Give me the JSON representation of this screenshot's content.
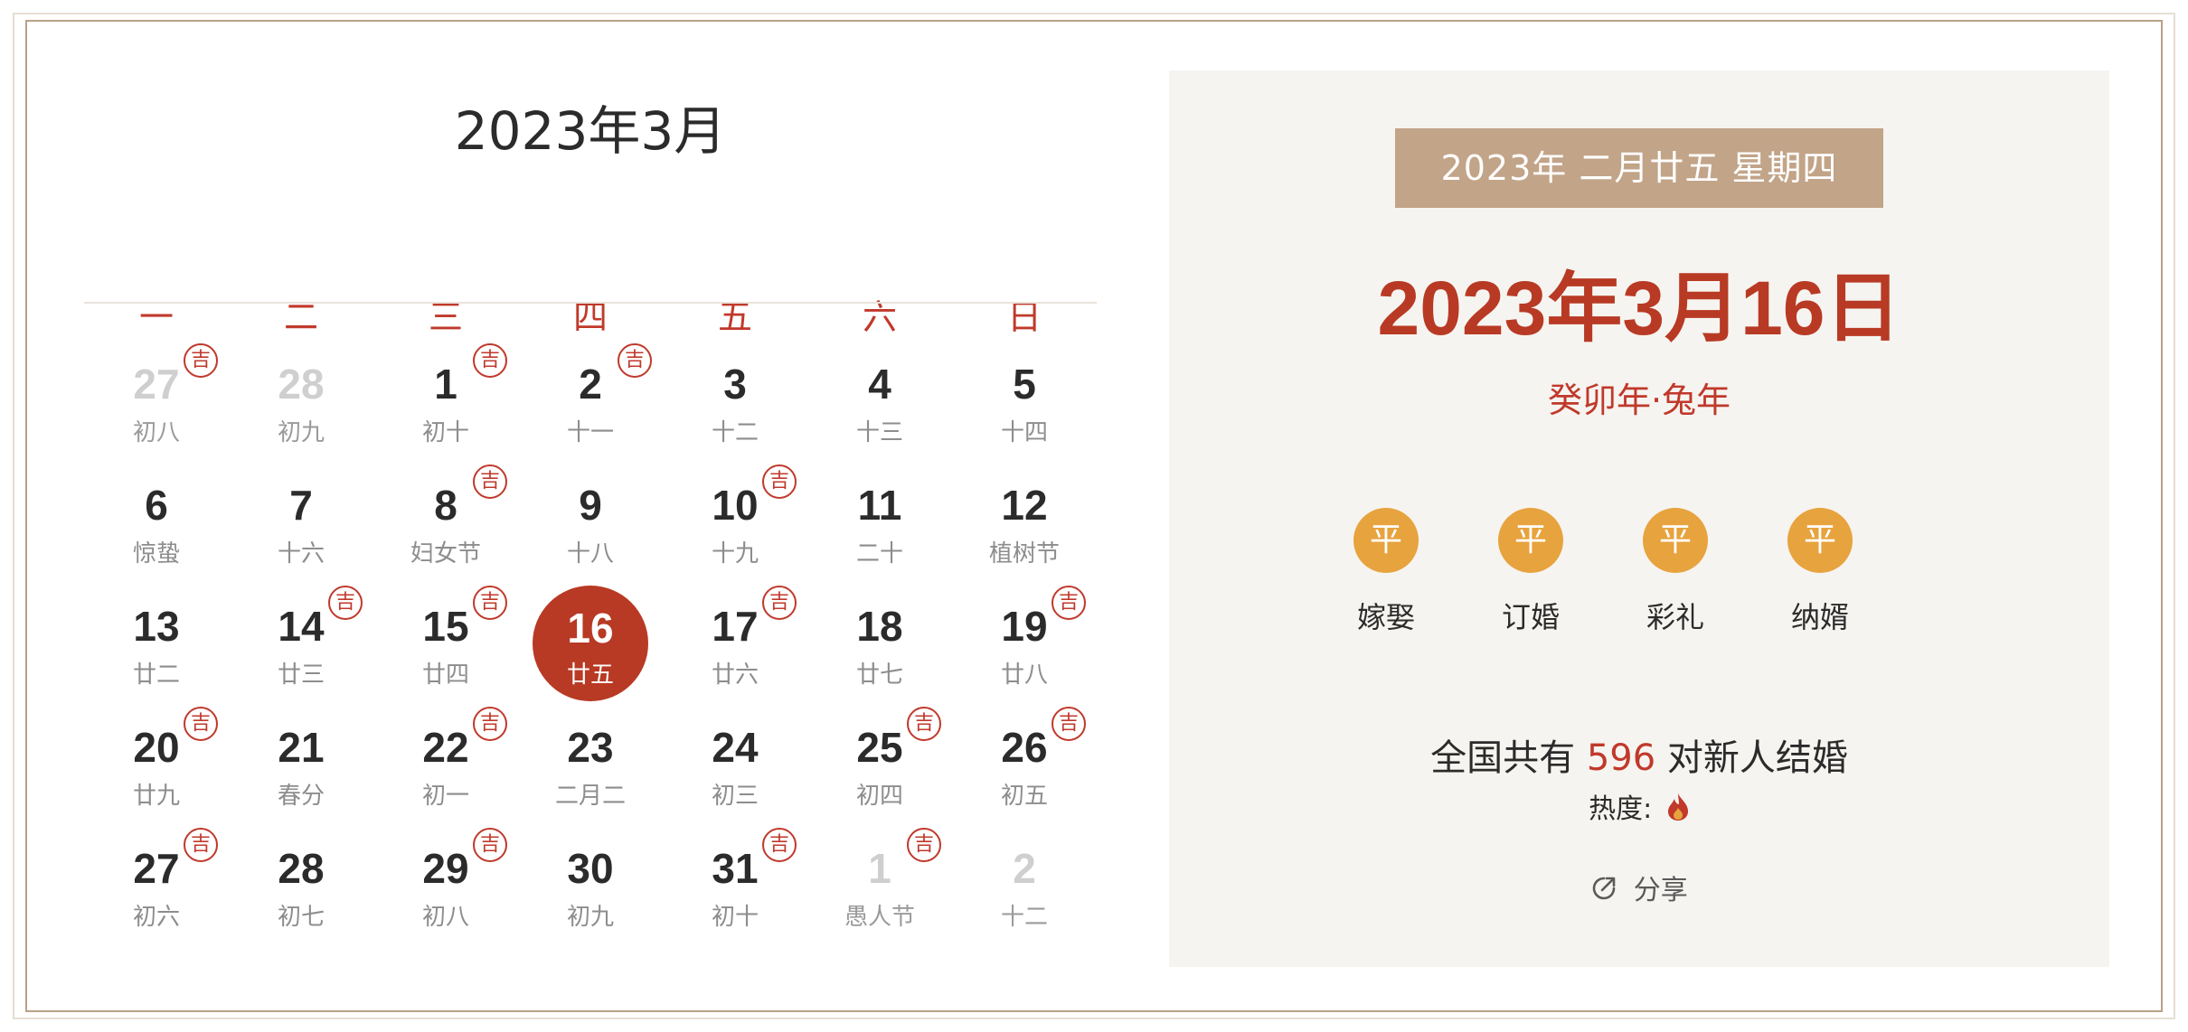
{
  "calendar": {
    "title": "2023年3月",
    "weekdays": [
      "一",
      "二",
      "三",
      "四",
      "五",
      "六",
      "日"
    ],
    "ji_label": "吉",
    "days": [
      {
        "num": "27",
        "lunar": "初八",
        "other": true,
        "ji": true
      },
      {
        "num": "28",
        "lunar": "初九",
        "other": true,
        "ji": false
      },
      {
        "num": "1",
        "lunar": "初十",
        "other": false,
        "ji": true
      },
      {
        "num": "2",
        "lunar": "十一",
        "other": false,
        "ji": true
      },
      {
        "num": "3",
        "lunar": "十二",
        "other": false,
        "ji": false
      },
      {
        "num": "4",
        "lunar": "十三",
        "other": false,
        "ji": false
      },
      {
        "num": "5",
        "lunar": "十四",
        "other": false,
        "ji": false
      },
      {
        "num": "6",
        "lunar": "惊蛰",
        "other": false,
        "ji": false
      },
      {
        "num": "7",
        "lunar": "十六",
        "other": false,
        "ji": false
      },
      {
        "num": "8",
        "lunar": "妇女节",
        "other": false,
        "ji": true
      },
      {
        "num": "9",
        "lunar": "十八",
        "other": false,
        "ji": false
      },
      {
        "num": "10",
        "lunar": "十九",
        "other": false,
        "ji": true
      },
      {
        "num": "11",
        "lunar": "二十",
        "other": false,
        "ji": false
      },
      {
        "num": "12",
        "lunar": "植树节",
        "other": false,
        "ji": false
      },
      {
        "num": "13",
        "lunar": "廿二",
        "other": false,
        "ji": false
      },
      {
        "num": "14",
        "lunar": "廿三",
        "other": false,
        "ji": true
      },
      {
        "num": "15",
        "lunar": "廿四",
        "other": false,
        "ji": true
      },
      {
        "num": "16",
        "lunar": "廿五",
        "other": false,
        "ji": false,
        "selected": true
      },
      {
        "num": "17",
        "lunar": "廿六",
        "other": false,
        "ji": true
      },
      {
        "num": "18",
        "lunar": "廿七",
        "other": false,
        "ji": false
      },
      {
        "num": "19",
        "lunar": "廿八",
        "other": false,
        "ji": true
      },
      {
        "num": "20",
        "lunar": "廿九",
        "other": false,
        "ji": true
      },
      {
        "num": "21",
        "lunar": "春分",
        "other": false,
        "ji": false
      },
      {
        "num": "22",
        "lunar": "初一",
        "other": false,
        "ji": true
      },
      {
        "num": "23",
        "lunar": "二月二",
        "other": false,
        "ji": false
      },
      {
        "num": "24",
        "lunar": "初三",
        "other": false,
        "ji": false
      },
      {
        "num": "25",
        "lunar": "初四",
        "other": false,
        "ji": true
      },
      {
        "num": "26",
        "lunar": "初五",
        "other": false,
        "ji": true
      },
      {
        "num": "27",
        "lunar": "初六",
        "other": false,
        "ji": true
      },
      {
        "num": "28",
        "lunar": "初七",
        "other": false,
        "ji": false
      },
      {
        "num": "29",
        "lunar": "初八",
        "other": false,
        "ji": true
      },
      {
        "num": "30",
        "lunar": "初九",
        "other": false,
        "ji": false
      },
      {
        "num": "31",
        "lunar": "初十",
        "other": false,
        "ji": true
      },
      {
        "num": "1",
        "lunar": "愚人节",
        "other": true,
        "ji": true
      },
      {
        "num": "2",
        "lunar": "十二",
        "other": true,
        "ji": false
      }
    ]
  },
  "detail": {
    "ribbon": "2023年  二月廿五  星期四",
    "date": "2023年3月16日",
    "ganzhi": "癸卯年·兔年",
    "tags": [
      {
        "badge": "平",
        "label": "嫁娶"
      },
      {
        "badge": "平",
        "label": "订婚"
      },
      {
        "badge": "平",
        "label": "彩礼"
      },
      {
        "badge": "平",
        "label": "纳婿"
      }
    ],
    "stats_prefix": "全国共有",
    "stats_count": "596",
    "stats_suffix": "对新人结婚",
    "heat_label": "热度:",
    "heat_icon": "flame-icon",
    "share_label": "分享",
    "share_icon": "share-icon"
  },
  "colors": {
    "accent": "#b83a24",
    "weekday": "#c0392b",
    "ribbon_bg": "#c2a488",
    "badge_bg": "#e7a33e",
    "panel_bg": "#f6f4f0"
  }
}
